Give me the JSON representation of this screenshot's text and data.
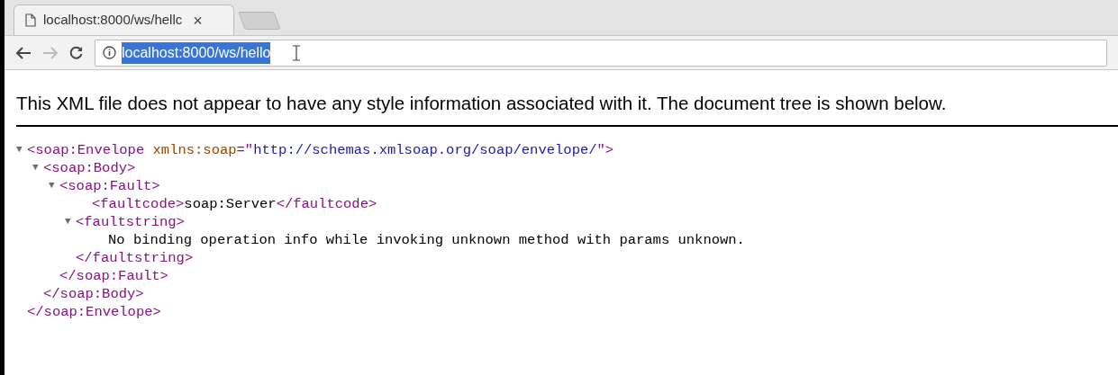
{
  "tabs": [
    {
      "title": "localhost:8000/ws/hellc",
      "close": "×",
      "selected": true
    }
  ],
  "address_bar": {
    "url": "localhost:8000/ws/hello",
    "url_selected": true
  },
  "notice": "This XML file does not appear to have any style information associated with it. The document tree is shown below.",
  "xml_tree": [
    {
      "toggle": "▼",
      "expanded": true,
      "tokens": [
        {
          "kind": "tag",
          "text": "<soap:Envelope"
        },
        {
          "kind": "attr_name",
          "text": " xmlns:soap"
        },
        {
          "kind": "tag",
          "text": "=\""
        },
        {
          "kind": "attr_value",
          "text": "http://schemas.xmlsoap.org/soap/envelope/"
        },
        {
          "kind": "tag",
          "text": "\">"
        }
      ],
      "close": "</soap:Envelope>",
      "children": [
        {
          "toggle": "▼",
          "expanded": true,
          "tokens": [
            {
              "kind": "tag",
              "text": "<soap:Body>"
            }
          ],
          "close": "</soap:Body>",
          "children": [
            {
              "toggle": "▼",
              "expanded": true,
              "tokens": [
                {
                  "kind": "tag",
                  "text": "<soap:Fault>"
                }
              ],
              "close": "</soap:Fault>",
              "children": [
                {
                  "tokens": [
                    {
                      "kind": "tag",
                      "text": "<faultcode>"
                    },
                    {
                      "kind": "text",
                      "text": "soap:Server"
                    },
                    {
                      "kind": "tag",
                      "text": "</faultcode>"
                    }
                  ]
                },
                {
                  "toggle": "▼",
                  "expanded": true,
                  "tokens": [
                    {
                      "kind": "tag",
                      "text": "<faultstring>"
                    }
                  ],
                  "close": "</faultstring>",
                  "children": [
                    {
                      "tokens": [
                        {
                          "kind": "text",
                          "text": "No binding operation info while invoking unknown method with params unknown."
                        }
                      ]
                    }
                  ]
                }
              ]
            }
          ]
        }
      ]
    }
  ]
}
